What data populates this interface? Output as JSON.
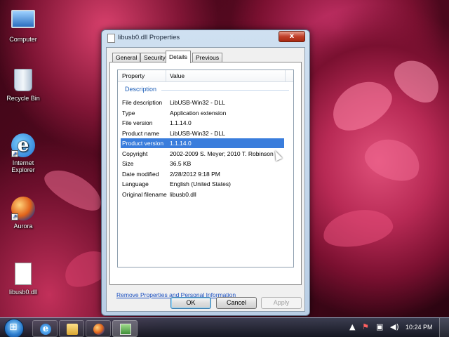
{
  "desktop": {
    "icons": [
      {
        "label": "Computer",
        "icon": "computer-icon"
      },
      {
        "label": "Recycle Bin",
        "icon": "recycle-bin-icon"
      },
      {
        "label": "Internet Explorer",
        "label_line1": "Internet",
        "label_line2": "Explorer",
        "icon": "internet-explorer-icon"
      },
      {
        "label": "Aurora",
        "icon": "aurora-icon"
      },
      {
        "label": "libusb0.dll",
        "icon": "dll-file-icon"
      }
    ]
  },
  "dialog": {
    "title": "libusb0.dll Properties",
    "close_label": "x",
    "tabs": [
      {
        "label": "General",
        "active": false
      },
      {
        "label": "Security",
        "active": false
      },
      {
        "label": "Details",
        "active": true
      },
      {
        "label": "Previous Versions",
        "active": false
      }
    ],
    "list": {
      "columns": [
        "Property",
        "Value"
      ],
      "group": "Description",
      "rows": [
        {
          "property": "File description",
          "value": "LibUSB-Win32 - DLL",
          "selected": false
        },
        {
          "property": "Type",
          "value": "Application extension",
          "selected": false
        },
        {
          "property": "File version",
          "value": "1.1.14.0",
          "selected": false
        },
        {
          "property": "Product name",
          "value": "LibUSB-Win32 - DLL",
          "selected": false
        },
        {
          "property": "Product version",
          "value": "1.1.14.0",
          "selected": true
        },
        {
          "property": "Copyright",
          "value": "2002-2009 S. Meyer; 2010 T. Robinson",
          "selected": false
        },
        {
          "property": "Size",
          "value": "36.5 KB",
          "selected": false
        },
        {
          "property": "Date modified",
          "value": "2/28/2012 9:18 PM",
          "selected": false
        },
        {
          "property": "Language",
          "value": "English (United States)",
          "selected": false
        },
        {
          "property": "Original filename",
          "value": "libusb0.dll",
          "selected": false
        }
      ]
    },
    "remove_link": "Remove Properties and Personal Information",
    "buttons": {
      "ok": "OK",
      "cancel": "Cancel",
      "apply": "Apply"
    }
  },
  "taskbar": {
    "clock": "10:24 PM",
    "pinned": [
      "internet-explorer-icon",
      "windows-explorer-icon",
      "aurora-icon",
      "control-panel-icon"
    ]
  },
  "colors": {
    "selection": "#3a7ddc",
    "link": "#1a4fc0",
    "group_header": "#1e5fb8"
  }
}
